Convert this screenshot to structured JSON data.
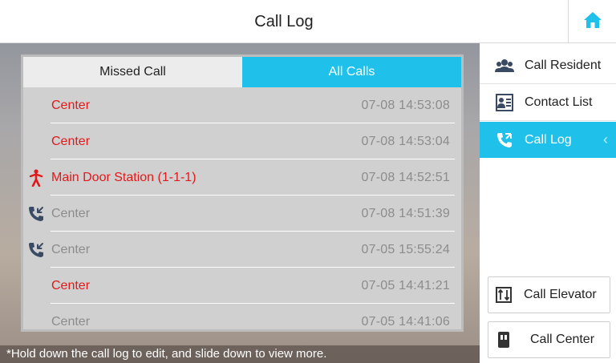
{
  "header": {
    "title": "Call Log"
  },
  "tabs": [
    {
      "label": "Missed Call",
      "active": false
    },
    {
      "label": "All Calls",
      "active": true
    }
  ],
  "calls": [
    {
      "name": "Center",
      "time": "07-08 14:53:08",
      "status": "missed",
      "icon": ""
    },
    {
      "name": "Center",
      "time": "07-08 14:53:04",
      "status": "missed",
      "icon": ""
    },
    {
      "name": "Main Door Station (1-1-1)",
      "time": "07-08 14:52:51",
      "status": "missed",
      "icon": "person-walking-icon"
    },
    {
      "name": "Center",
      "time": "07-08 14:51:39",
      "status": "answered",
      "icon": "incoming-call-icon"
    },
    {
      "name": "Center",
      "time": "07-05 15:55:24",
      "status": "answered",
      "icon": "incoming-call-icon"
    },
    {
      "name": "Center",
      "time": "07-05 14:41:21",
      "status": "missed",
      "icon": ""
    },
    {
      "name": "Center",
      "time": "07-05 14:41:06",
      "status": "answered",
      "icon": ""
    }
  ],
  "hint": "*Hold down the call log to edit, and slide down to view more.",
  "sidebar": {
    "items": [
      {
        "label": "Call Resident",
        "icon": "residents-icon",
        "active": false
      },
      {
        "label": "Contact List",
        "icon": "contact-list-icon",
        "active": false
      },
      {
        "label": "Call Log",
        "icon": "call-log-icon",
        "active": true
      }
    ],
    "buttons": [
      {
        "label": "Call Elevator",
        "icon": "elevator-icon"
      },
      {
        "label": "Call Center",
        "icon": "call-center-icon"
      }
    ]
  },
  "colors": {
    "accent": "#1fc0ea",
    "missed": "#e01a1a",
    "answered": "#8c8c8c"
  }
}
